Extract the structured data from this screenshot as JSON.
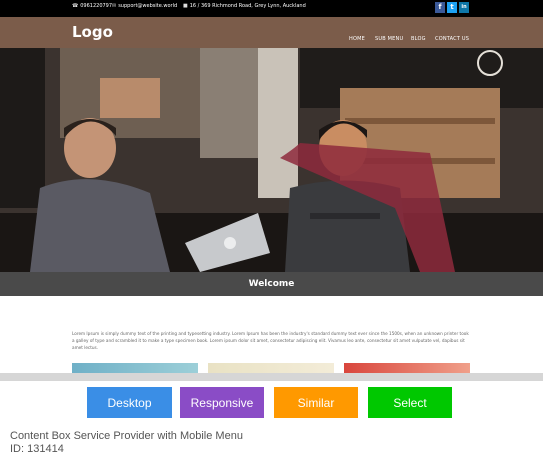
{
  "topbar": {
    "phone": "0961220797",
    "email": "support@website.world",
    "address": "16 / 369 Richmond Road, Grey Lynn, Auckland",
    "social": [
      "f",
      "t",
      "in"
    ]
  },
  "navbar": {
    "logo": "Logo",
    "menu": [
      "HOME",
      "SUB MENU",
      "BLOG",
      "CONTACT US"
    ]
  },
  "welcome": "Welcome",
  "intro": "Lorem Ipsum is simply dummy text of the printing and typesetting industry. Lorem Ipsum has been the industry's standard dummy text ever since the 1500s, when an unknown printer took a galley of type and scrambled it to make a type specimen book. Lorem ipsum dolor sit amet, consectetur adipiscing elit. Vivamus leo ante, consectetur sit amet vulputate vel, dapibus sit amet lectus.",
  "actions": {
    "desktop": "Desktop",
    "responsive": "Responsive",
    "similar": "Similar",
    "select": "Select"
  },
  "caption": {
    "title": "Content Box Service Provider with Mobile Menu",
    "id": "ID: 131414"
  },
  "colors": {
    "topbar": "#000000",
    "navbar": "#7b5c4a",
    "welcome_bar": "#4a4a4a",
    "desktop": "#3a8ee6",
    "responsive": "#8a4cc6",
    "similar": "#ff9900",
    "select": "#00c800"
  }
}
